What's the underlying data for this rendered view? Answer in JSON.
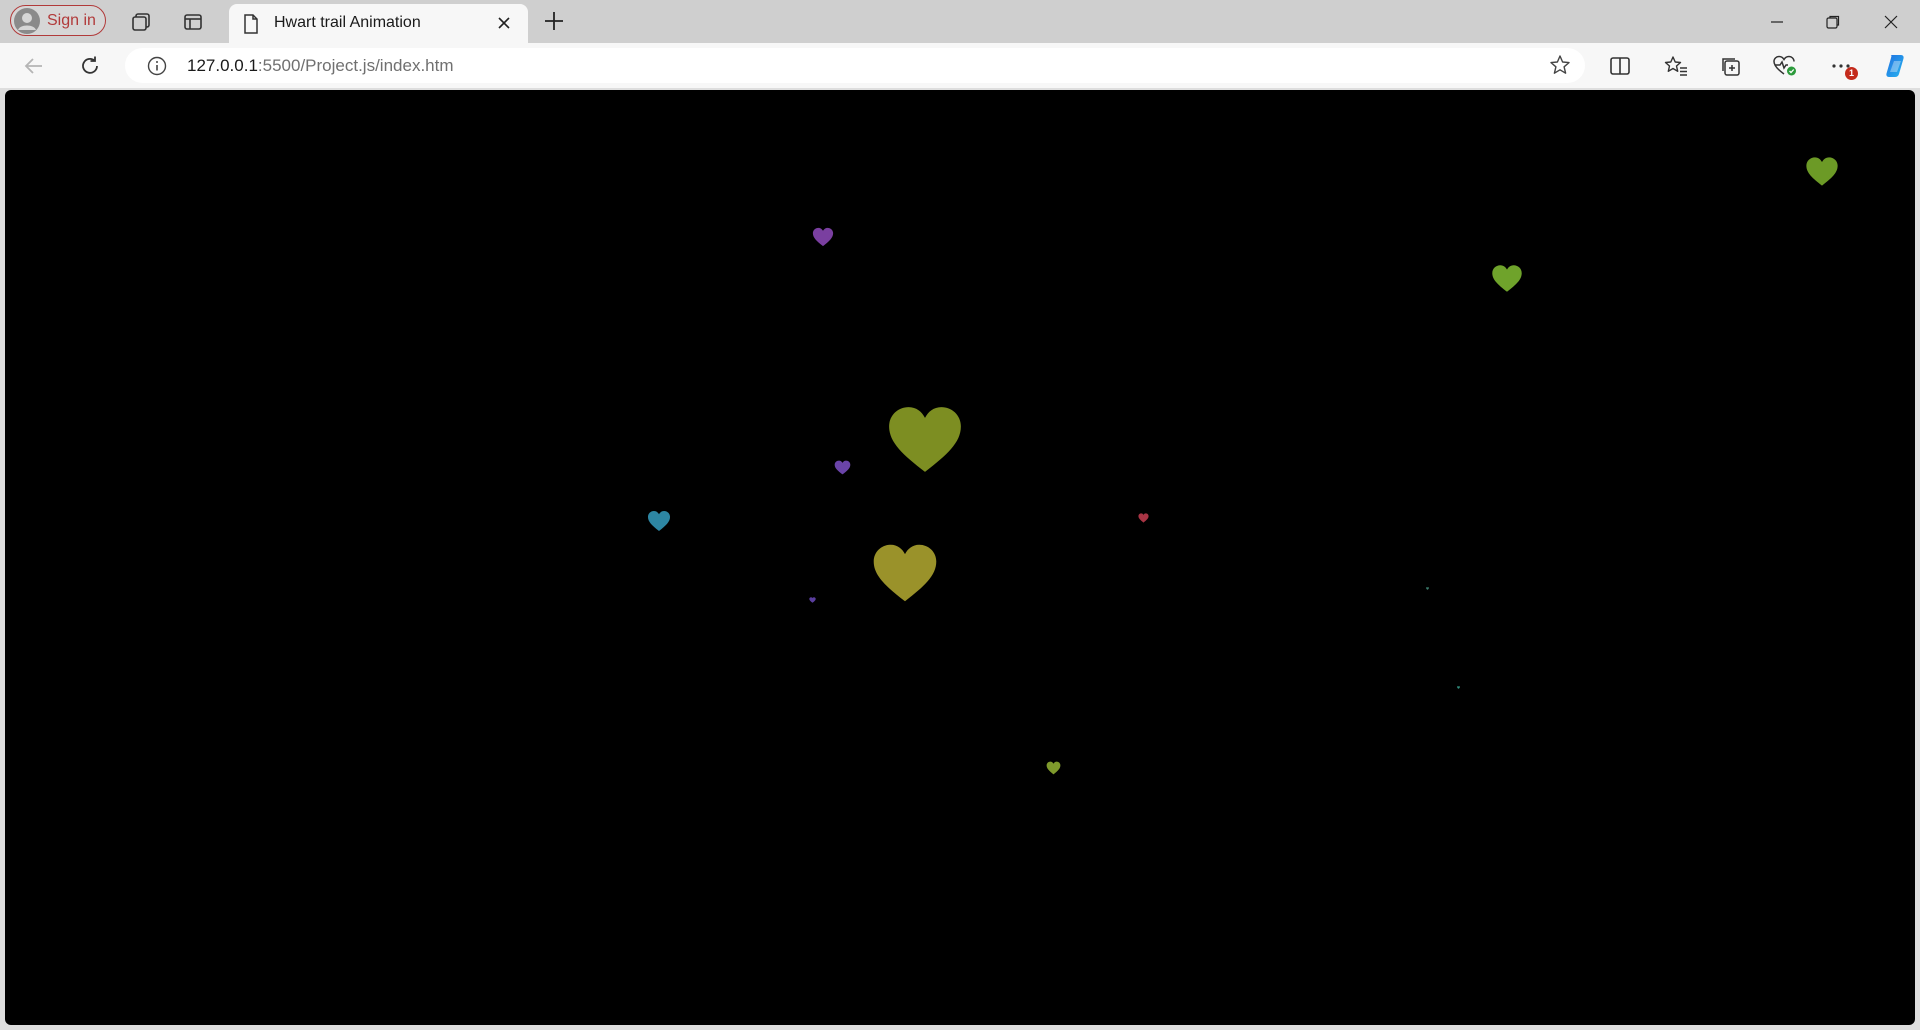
{
  "browser": {
    "sign_in_label": "Sign in",
    "tab_title": "Hwart trail Animation",
    "url_host": "127.0.0.1",
    "url_rest": ":5500/Project.js/index.htm",
    "notification_count": "1"
  },
  "icons": {
    "profile": "person-icon",
    "workspaces": "workspaces-icon",
    "tab_actions": "vertical-tabs-icon",
    "page": "document-icon",
    "close_tab": "close-icon",
    "new_tab": "plus-icon",
    "minimize": "minimize-icon",
    "restore": "restore-icon",
    "close_window": "close-icon",
    "back": "arrow-left-icon",
    "refresh": "refresh-icon",
    "site_info": "info-icon",
    "favorite": "star-icon",
    "split_screen": "split-screen-icon",
    "favorites": "favorites-icon",
    "collections": "collections-icon",
    "browser_essentials": "heart-pulse-icon",
    "more": "more-icon",
    "copilot": "copilot-icon"
  },
  "canvas": {
    "background": "#000000",
    "hearts": [
      {
        "color": "#6c9a26"
      },
      {
        "color": "#6fa32b"
      },
      {
        "color": "#7a3fa0"
      },
      {
        "color": "#7d8e22"
      },
      {
        "color": "#6a44a8"
      },
      {
        "color": "#2d86a3"
      },
      {
        "color": "#a83444"
      },
      {
        "color": "#9a922a"
      },
      {
        "color": "#5a3e9e"
      },
      {
        "color": "#7f9a2c"
      },
      {
        "color": "#3a7a6a"
      },
      {
        "color": "#2f8a7a"
      }
    ]
  },
  "colors": {
    "signin_accent": "#b13a3a",
    "copilot_blue": "#1d8ae8",
    "badge_red": "#c42b1c"
  }
}
